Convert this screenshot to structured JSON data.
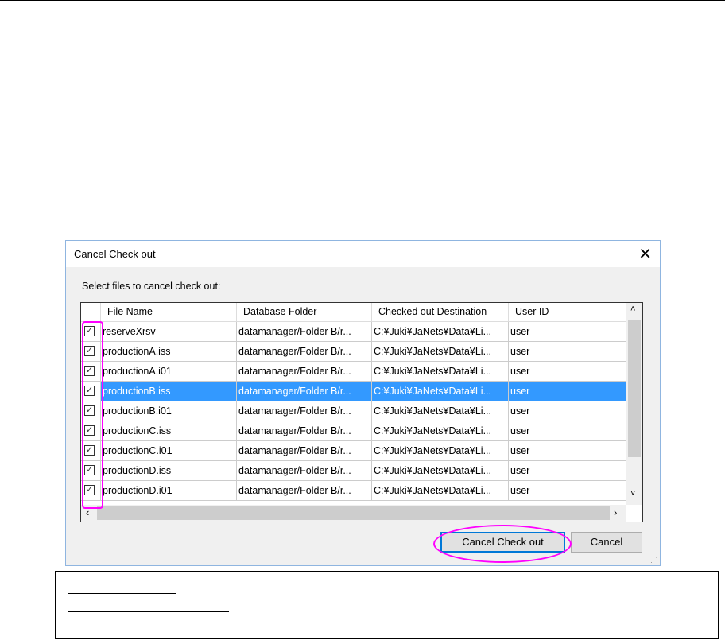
{
  "dialog": {
    "title": "Cancel Check out",
    "prompt": "Select files to cancel check out:",
    "ok_label": "Cancel Check out",
    "cancel_label": "Cancel"
  },
  "table": {
    "columns": [
      "File Name",
      "Database Folder",
      "Checked out Destination",
      "User ID"
    ],
    "rows": [
      {
        "file": "reserveXrsv",
        "folder": "datamanager/Folder B/r...",
        "dest": "C:¥Juki¥JaNets¥Data¥Li...",
        "user": "user",
        "checked": true
      },
      {
        "file": "productionA.iss",
        "folder": "datamanager/Folder B/r...",
        "dest": "C:¥Juki¥JaNets¥Data¥Li...",
        "user": "user",
        "checked": true
      },
      {
        "file": "productionA.i01",
        "folder": "datamanager/Folder B/r...",
        "dest": "C:¥Juki¥JaNets¥Data¥Li...",
        "user": "user",
        "checked": true
      },
      {
        "file": "productionB.iss",
        "folder": "datamanager/Folder B/r...",
        "dest": "C:¥Juki¥JaNets¥Data¥Li...",
        "user": "user",
        "checked": true,
        "selected": true
      },
      {
        "file": "productionB.i01",
        "folder": "datamanager/Folder B/r...",
        "dest": "C:¥Juki¥JaNets¥Data¥Li...",
        "user": "user",
        "checked": true
      },
      {
        "file": "productionC.iss",
        "folder": "datamanager/Folder B/r...",
        "dest": "C:¥Juki¥JaNets¥Data¥Li...",
        "user": "user",
        "checked": true
      },
      {
        "file": "productionC.i01",
        "folder": "datamanager/Folder B/r...",
        "dest": "C:¥Juki¥JaNets¥Data¥Li...",
        "user": "user",
        "checked": true
      },
      {
        "file": "productionD.iss",
        "folder": "datamanager/Folder B/r...",
        "dest": "C:¥Juki¥JaNets¥Data¥Li...",
        "user": "user",
        "checked": true
      },
      {
        "file": "productionD.i01",
        "folder": "datamanager/Folder B/r...",
        "dest": "C:¥Juki¥JaNets¥Data¥Li...",
        "user": "user",
        "checked": true
      }
    ]
  },
  "colors": {
    "highlight": "#ff00ff",
    "selection": "#3399ff"
  }
}
